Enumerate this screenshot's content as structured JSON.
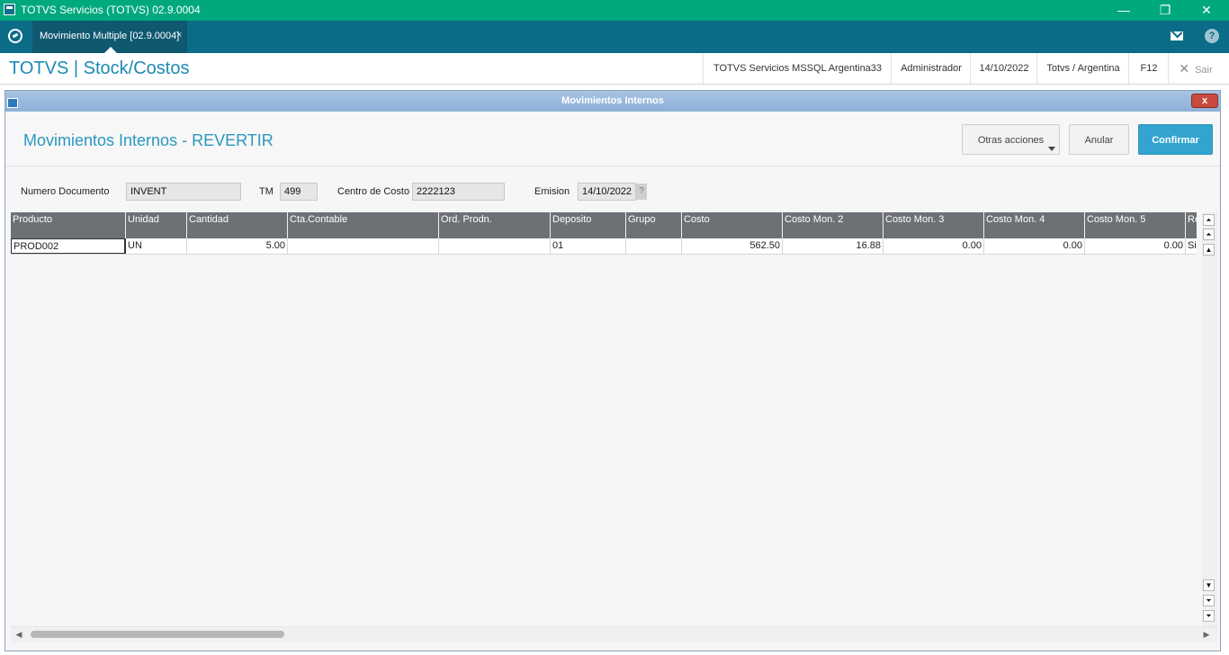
{
  "window": {
    "title": "TOTVS Servicios (TOTVS) 02.9.0004",
    "minimize": "—",
    "restore": "❐",
    "close": "✕"
  },
  "tabbar": {
    "tab_label": "Movimiento Multiple [02.9.0004]",
    "tab_close": "×"
  },
  "module": {
    "title": "TOTVS | Stock/Costos",
    "environment": "TOTVS Servicios MSSQL Argentina33",
    "user": "Administrador",
    "date": "14/10/2022",
    "company": "Totvs / Argentina",
    "shortcut": "F12",
    "exit_label": "Sair"
  },
  "dialog": {
    "title": "Movimientos Internos",
    "close": "x",
    "heading": "Movimientos Internos - REVERTIR",
    "buttons": {
      "other_actions": "Otras acciones",
      "cancel": "Anular",
      "confirm": "Confirmar"
    },
    "fields": {
      "doc_label": "Numero Documento",
      "doc_value": "INVENT",
      "tm_label": "TM",
      "tm_value": "499",
      "cost_center_label": "Centro de Costo",
      "cost_center_value": "2222123",
      "emission_label": "Emision",
      "emission_value": "14/10/2022",
      "lookup": "?"
    }
  },
  "grid": {
    "columns": [
      "Producto",
      "Unidad",
      "Cantidad",
      "Cta.Contable",
      "Ord. Prodn.",
      "Deposito",
      "Grupo",
      "Costo",
      "Costo Mon. 2",
      "Costo Mon. 3",
      "Costo Mon. 4",
      "Costo Mon. 5",
      "Rev"
    ],
    "rows": [
      [
        "PROD002",
        "UN",
        "5.00",
        "",
        "",
        "01",
        "",
        "562.50",
        "16.88",
        "0.00",
        "0.00",
        "0.00",
        "Si"
      ]
    ]
  },
  "scrollbars": {
    "top": "⏶",
    "page_up": "⏶",
    "up": "▲",
    "down": "▼",
    "page_down": "⏷",
    "bottom": "⏷",
    "left": "◀",
    "right": "▶"
  }
}
